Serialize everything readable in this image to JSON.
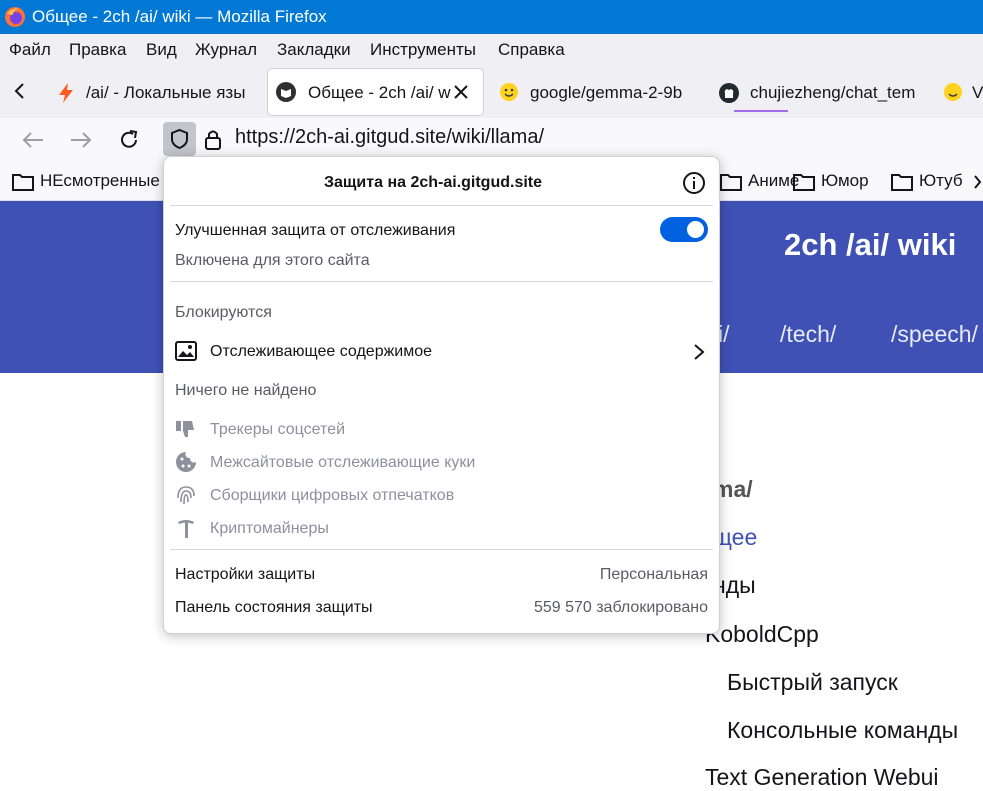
{
  "window": {
    "title": "Общее - 2ch /ai/ wiki — Mozilla Firefox"
  },
  "menu": [
    "Файл",
    "Правка",
    "Вид",
    "Журнал",
    "Закладки",
    "Инструменты",
    "Справка"
  ],
  "tabs": [
    {
      "label": "/ai/ - Локальные язы"
    },
    {
      "label": "Общее - 2ch /ai/ w"
    },
    {
      "label": "google/gemma-2-9b"
    },
    {
      "label": "chujiezheng/chat_tem"
    }
  ],
  "address": {
    "url": "https://2ch-ai.gitgud.site/wiki/llama/"
  },
  "bookmarks": [
    "НЕсмотренные",
    "Аниме",
    "Юмор",
    "Ютуб"
  ],
  "site": {
    "title": "2ch /ai/ wiki",
    "nav": [
      "i/",
      "/tech/",
      "/speech/"
    ],
    "toc": {
      "path": "ma/",
      "current": "щее",
      "commands": "нды",
      "koboldcpp": "KoboldCpp",
      "quickstart": "Быстрый запуск",
      "console": "Консольные команды",
      "tgw": "Text Generation Webui"
    }
  },
  "panel": {
    "header": "Защита на 2ch-ai.gitgud.site",
    "etp_label": "Улучшенная защита от отслеживания",
    "etp_status": "Включена для этого сайта",
    "etp_enabled": true,
    "blocked_heading": "Блокируются",
    "tracking_content": "Отслеживающее содержимое",
    "none_found_heading": "Ничего не найдено",
    "none_found": [
      {
        "label": "Трекеры соцсетей",
        "icon": "thumbs-down-icon"
      },
      {
        "label": "Межсайтовые отслеживающие куки",
        "icon": "cookie-icon"
      },
      {
        "label": "Сборщики цифровых отпечатков",
        "icon": "fingerprint-icon"
      },
      {
        "label": "Криптомайнеры",
        "icon": "pickaxe-icon"
      }
    ],
    "settings_label": "Настройки защиты",
    "settings_value": "Персональная",
    "dashboard_label": "Панель состояния защиты",
    "dashboard_value": "559 570 заблокировано"
  },
  "colors": {
    "accent": "#0061e0",
    "header": "#3f51b5",
    "titlebar": "#0078d4"
  }
}
